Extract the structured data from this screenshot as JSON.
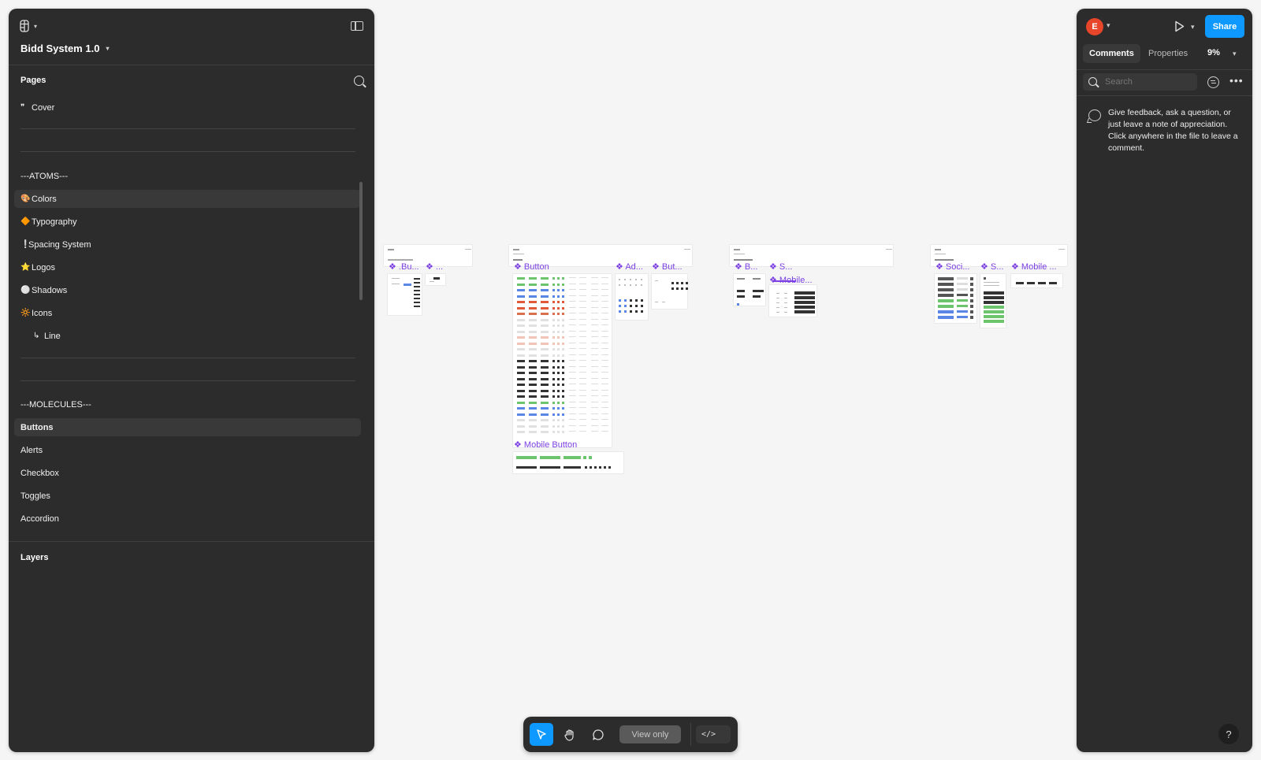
{
  "app": {
    "file_title": "Bidd System 1.0"
  },
  "left_panel": {
    "pages_header": "Pages",
    "pages": [
      {
        "emoji": "❞",
        "label": "Cover"
      },
      {
        "emoji": "",
        "label": ""
      },
      {
        "emoji": "",
        "label": "---ATOMS---"
      },
      {
        "emoji": "🎨",
        "label": "Colors"
      },
      {
        "emoji": "🔶",
        "label": "Typography"
      },
      {
        "emoji": "❕",
        "label": "Spacing System"
      },
      {
        "emoji": "⭐",
        "label": "Logos"
      },
      {
        "emoji": "⚪",
        "label": "Shadows"
      },
      {
        "emoji": "🔆",
        "label": "Icons"
      },
      {
        "emoji": "↳",
        "label": "Line"
      },
      {
        "emoji": "",
        "label": "---MOLECULES---"
      },
      {
        "emoji": "",
        "label": "Buttons"
      },
      {
        "emoji": "",
        "label": "Alerts"
      },
      {
        "emoji": "",
        "label": "Checkbox"
      },
      {
        "emoji": "",
        "label": "Toggles"
      },
      {
        "emoji": "",
        "label": "Accordion"
      }
    ],
    "layers_header": "Layers"
  },
  "right_panel": {
    "avatar_letter": "E",
    "share_label": "Share",
    "tabs": [
      "Comments",
      "Properties"
    ],
    "zoom": "9%",
    "search_placeholder": "Search",
    "help_text": "Give feedback, ask a question, or just leave a note of appreciation. Click anywhere in the file to leave a comment.",
    "help_button": "?"
  },
  "toolbar": {
    "view_only": "View only",
    "code_label": "</>"
  },
  "canvas": {
    "frame_labels": [
      ".Bu...",
      "...",
      "Button",
      "Ad...",
      "But...",
      "B...",
      "S...",
      "Mobile...",
      "Soci...",
      "S...",
      "Mobile ...",
      "Mobile Button"
    ],
    "frame_headers": [
      "Shadows and Blurs",
      "Button",
      "Button Groups",
      "Social Buttons"
    ]
  },
  "colors": {
    "accent": "#0d99ff",
    "avatar": "#e8462a",
    "panel": "#2c2c2c",
    "canvas": "#f5f5f5",
    "component_label": "#7b3fe4"
  }
}
